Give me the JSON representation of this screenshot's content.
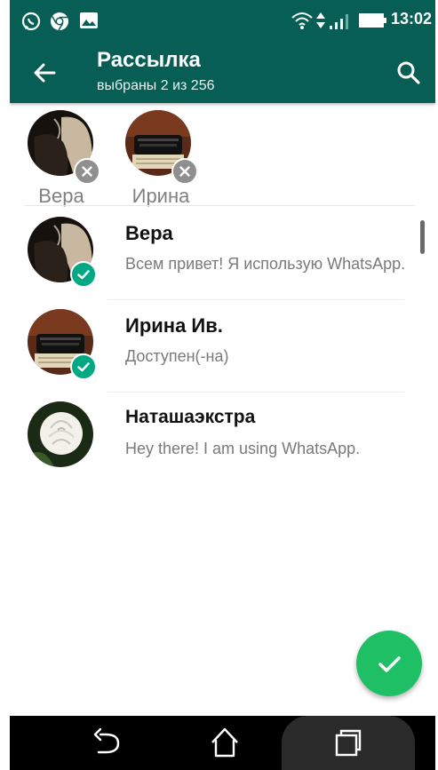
{
  "status_bar": {
    "time": "13:02",
    "icons": [
      "whatsapp-icon",
      "chrome-icon",
      "image-icon",
      "wifi-icon",
      "signal-icon",
      "battery-icon"
    ]
  },
  "app_bar": {
    "title": "Рассылка",
    "subtitle": "выбраны 2 из 256"
  },
  "selected": [
    {
      "name": "Вера",
      "avatar": "bedroom-photo-avatar"
    },
    {
      "name": "Ирина",
      "avatar": "typewriter-photo-avatar"
    }
  ],
  "contacts": [
    {
      "name": "Вера",
      "status": "Всем привет! Я использую WhatsApp.",
      "selected": true,
      "avatar": "bedroom-photo-avatar"
    },
    {
      "name": "Ирина Ив.",
      "status": "Доступен(-на)",
      "selected": true,
      "avatar": "typewriter-photo-avatar"
    },
    {
      "name": "Наташаэкстра",
      "status": "Hey there! I am using WhatsApp.",
      "selected": false,
      "avatar": "white-rose-avatar"
    }
  ],
  "colors": {
    "header": "#075e54",
    "check": "#00a884",
    "fab": "#1fbf66",
    "remove": "#8f8f8f"
  }
}
